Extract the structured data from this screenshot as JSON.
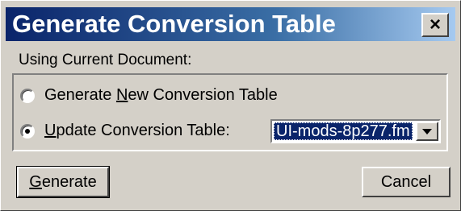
{
  "window": {
    "title": "Generate Conversion Table",
    "close_icon": "×"
  },
  "subtitle": "Using Current Document:",
  "options": {
    "new_table": {
      "label_mn": "N",
      "label_pre": "Generate ",
      "label_post": "ew Conversion Table",
      "checked": false
    },
    "update_table": {
      "label_mn": "U",
      "label_pre": "",
      "label_post": "pdate Conversion Table:",
      "checked": true
    }
  },
  "dropdown": {
    "selected": "UI-mods-8p277.fm"
  },
  "buttons": {
    "generate": {
      "mn": "G",
      "rest": "enerate"
    },
    "cancel": "Cancel"
  }
}
